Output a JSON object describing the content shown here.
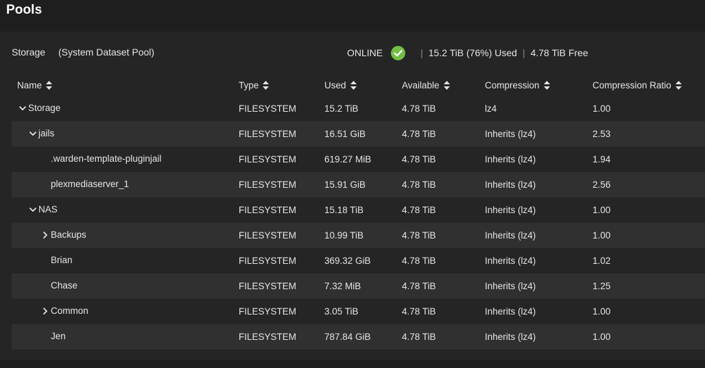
{
  "page": {
    "title": "Pools"
  },
  "pool": {
    "name": "Storage",
    "tag": "(System Dataset Pool)",
    "status": "ONLINE",
    "used": "15.2 TiB (76%) Used",
    "free": "4.78 TiB Free",
    "separator": "|",
    "status_color": "#71bf44"
  },
  "columns": [
    "Name",
    "Type",
    "Used",
    "Available",
    "Compression",
    "Compression Ratio"
  ],
  "rows": [
    {
      "name": "Storage",
      "indent": 0,
      "expander": "expanded",
      "type": "FILESYSTEM",
      "used": "15.2 TiB",
      "available": "4.78 TiB",
      "compression": "lz4",
      "ratio": "1.00"
    },
    {
      "name": "jails",
      "indent": 1,
      "expander": "expanded",
      "type": "FILESYSTEM",
      "used": "16.51 GiB",
      "available": "4.78 TiB",
      "compression": "Inherits (lz4)",
      "ratio": "2.53"
    },
    {
      "name": ".warden-template-pluginjail",
      "indent": 2,
      "expander": "none",
      "type": "FILESYSTEM",
      "used": "619.27 MiB",
      "available": "4.78 TiB",
      "compression": "Inherits (lz4)",
      "ratio": "1.94"
    },
    {
      "name": "plexmediaserver_1",
      "indent": 2,
      "expander": "none",
      "type": "FILESYSTEM",
      "used": "15.91 GiB",
      "available": "4.78 TiB",
      "compression": "Inherits (lz4)",
      "ratio": "2.56"
    },
    {
      "name": "NAS",
      "indent": 1,
      "expander": "expanded",
      "type": "FILESYSTEM",
      "used": "15.18 TiB",
      "available": "4.78 TiB",
      "compression": "Inherits (lz4)",
      "ratio": "1.00"
    },
    {
      "name": "Backups",
      "indent": 2,
      "expander": "collapsed",
      "type": "FILESYSTEM",
      "used": "10.99 TiB",
      "available": "4.78 TiB",
      "compression": "Inherits (lz4)",
      "ratio": "1.00"
    },
    {
      "name": "Brian",
      "indent": 2,
      "expander": "none",
      "type": "FILESYSTEM",
      "used": "369.32 GiB",
      "available": "4.78 TiB",
      "compression": "Inherits (lz4)",
      "ratio": "1.02"
    },
    {
      "name": "Chase",
      "indent": 2,
      "expander": "none",
      "type": "FILESYSTEM",
      "used": "7.32 MiB",
      "available": "4.78 TiB",
      "compression": "Inherits (lz4)",
      "ratio": "1.25"
    },
    {
      "name": "Common",
      "indent": 2,
      "expander": "collapsed",
      "type": "FILESYSTEM",
      "used": "3.05 TiB",
      "available": "4.78 TiB",
      "compression": "Inherits (lz4)",
      "ratio": "1.00"
    },
    {
      "name": "Jen",
      "indent": 2,
      "expander": "none",
      "type": "FILESYSTEM",
      "used": "787.84 GiB",
      "available": "4.78 TiB",
      "compression": "Inherits (lz4)",
      "ratio": "1.00"
    }
  ]
}
